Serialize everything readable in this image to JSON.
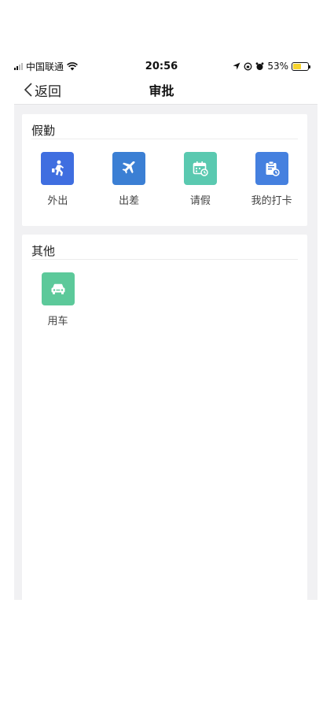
{
  "status_bar": {
    "carrier": "中国联通",
    "time": "20:56",
    "battery_percent": "53%",
    "battery_level": 0.53
  },
  "nav": {
    "back_label": "返回",
    "title": "审批"
  },
  "sections": [
    {
      "title": "假勤",
      "items": [
        {
          "label": "外出",
          "icon": "walking-person-icon",
          "color": "#3f6ee0"
        },
        {
          "label": "出差",
          "icon": "airplane-icon",
          "color": "#3b7fd4"
        },
        {
          "label": "请假",
          "icon": "calendar-clock-icon",
          "color": "#5ac9b0"
        },
        {
          "label": "我的打卡",
          "icon": "clipboard-clock-icon",
          "color": "#4580df"
        }
      ]
    },
    {
      "title": "其他",
      "items": [
        {
          "label": "用车",
          "icon": "car-icon",
          "color": "#5cc99a"
        }
      ]
    }
  ]
}
